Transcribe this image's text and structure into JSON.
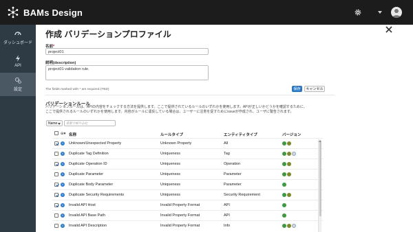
{
  "topbar": {
    "brand": "BAMs Design",
    "settings_icon": "gear-icon",
    "menu_icon": "chevron-down-icon",
    "user_icon": "user-avatar-icon",
    "background": "#1c1c1c"
  },
  "sidebar": {
    "items": [
      {
        "label": "ダッシュボード",
        "icon": "dashboard-icon",
        "active": false
      },
      {
        "label": "API",
        "icon": "bolt-icon",
        "active": false
      },
      {
        "label": "設定",
        "icon": "cogs-icon",
        "active": true
      }
    ],
    "background": "#2e3a44",
    "active_background": "#4a5864"
  },
  "form": {
    "title": "作成 バリデーションプロファイル",
    "name_label": "名前",
    "name_required": "*",
    "name_value": "project01",
    "description_label": "説明(description)",
    "description_value": "project01 validation rule.",
    "required_note": "The fields marked with * are required.(TBD)",
    "save_label": "保存",
    "cancel_label": "キャンセル",
    "accent": "#2f7dc9"
  },
  "rules": {
    "title": "バリデーションルール",
    "description_line1": "バリデーションルールは、APIの内容をチェックする方法を提供します。ここで提供されているルールのいずれかを使用します。APIが正しいかどうかを確認するために、",
    "description_line2": "ここで提供されるルールのいずれかを使用します。内容がルールに違反している場合は、ユーザーに注意を促すためにissueが作成され、ユーザに警告されます。",
    "filter_field": "Name",
    "filter_placeholder": "名前で絞り込む",
    "columns": {
      "name": "名称",
      "rule_type": "ルールタイプ",
      "entity_type": "エンティティタイプ",
      "version": "バージョン"
    },
    "rows": [
      {
        "checked": true,
        "name": "Unknown/Unexpected Property",
        "rule_type": "Unknown Property",
        "entity_type": "All",
        "versions": [
          "g",
          "d"
        ]
      },
      {
        "checked": false,
        "name": "Duplicate Tag Definition",
        "rule_type": "Uniqueness",
        "entity_type": "Tag",
        "versions": [
          "g",
          "d",
          "s"
        ]
      },
      {
        "checked": true,
        "name": "Duplicate Operation ID",
        "rule_type": "Uniqueness",
        "entity_type": "Operation",
        "versions": [
          "g",
          "d"
        ]
      },
      {
        "checked": false,
        "name": "Duplicate Parameter",
        "rule_type": "Uniqueness",
        "entity_type": "Parameter",
        "versions": [
          "g",
          "d"
        ]
      },
      {
        "checked": true,
        "name": "Duplicate Body Parameter",
        "rule_type": "Uniqueness",
        "entity_type": "Parameter",
        "versions": [
          "g"
        ]
      },
      {
        "checked": true,
        "name": "Duplicate Security Requirements",
        "rule_type": "Uniqueness",
        "entity_type": "Security Requirement",
        "versions": [
          "g",
          "d"
        ]
      },
      {
        "checked": true,
        "name": "Invalid API Host",
        "rule_type": "Invalid Property Format",
        "entity_type": "API",
        "versions": [
          "g"
        ]
      },
      {
        "checked": false,
        "name": "Invalid API Base Path",
        "rule_type": "Invalid Property Format",
        "entity_type": "API",
        "versions": [
          "g"
        ]
      },
      {
        "checked": false,
        "name": "Invalid API Description",
        "rule_type": "Invalid Property Format",
        "entity_type": "Info",
        "versions": [
          "g",
          "d",
          "s"
        ]
      }
    ]
  }
}
